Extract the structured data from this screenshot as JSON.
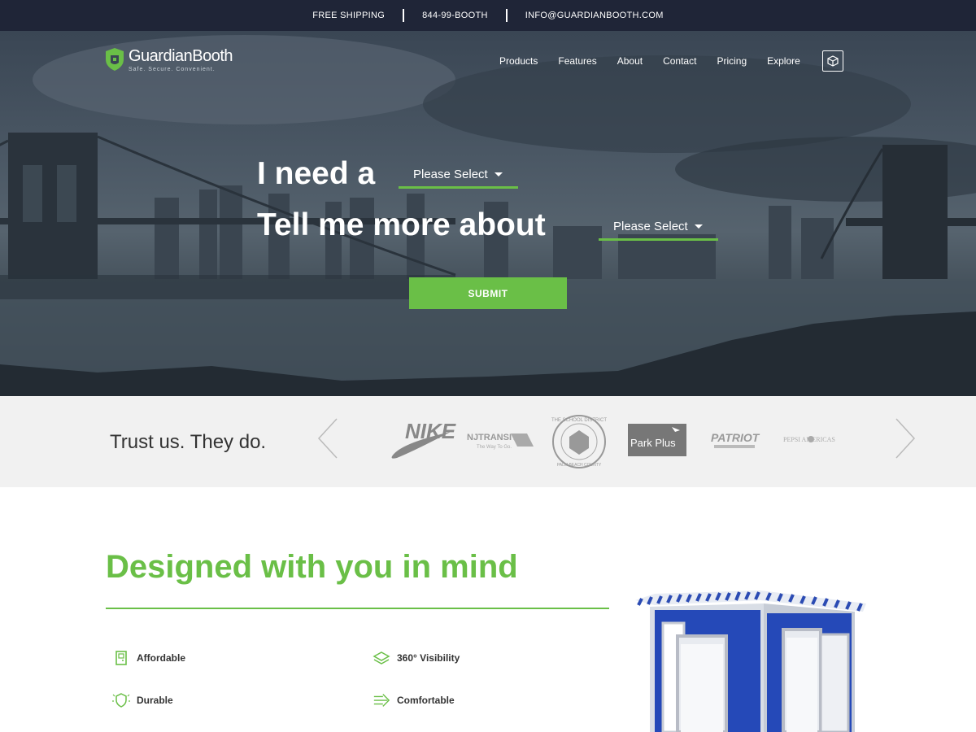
{
  "topbar": {
    "shipping": "FREE SHIPPING",
    "phone": "844-99-BOOTH",
    "email": "INFO@GUARDIANBOOTH.COM"
  },
  "brand": {
    "name": "GuardianBooth",
    "tagline": "Safe. Secure. Convenient.",
    "accent_color": "#6abf47",
    "topbar_color": "#1f2537"
  },
  "nav": {
    "items": [
      "Products",
      "Features",
      "About",
      "Contact",
      "Pricing",
      "Explore"
    ],
    "icon": "cube-icon"
  },
  "hero": {
    "line1": "I need a",
    "line2": "Tell me more about",
    "select1": "Please Select",
    "select2": "Please Select",
    "submit": "SUBMIT"
  },
  "trust": {
    "title": "Trust us. They do.",
    "logos": [
      "NIKE",
      "NJTRANSIT",
      "The Way To Go.",
      "THE SCHOOL DISTRICT",
      "PALM BEACH COUNTY",
      "Park Plus",
      "PATRIOT",
      "PEPSI AMERICAS"
    ]
  },
  "features": {
    "title": "Designed with you in mind",
    "items": [
      {
        "label": "Affordable",
        "icon": "door-icon"
      },
      {
        "label": "360° Visibility",
        "icon": "layers-icon"
      },
      {
        "label": "Durable",
        "icon": "shield-gear-icon"
      },
      {
        "label": "Comfortable",
        "icon": "airflow-icon"
      }
    ]
  }
}
